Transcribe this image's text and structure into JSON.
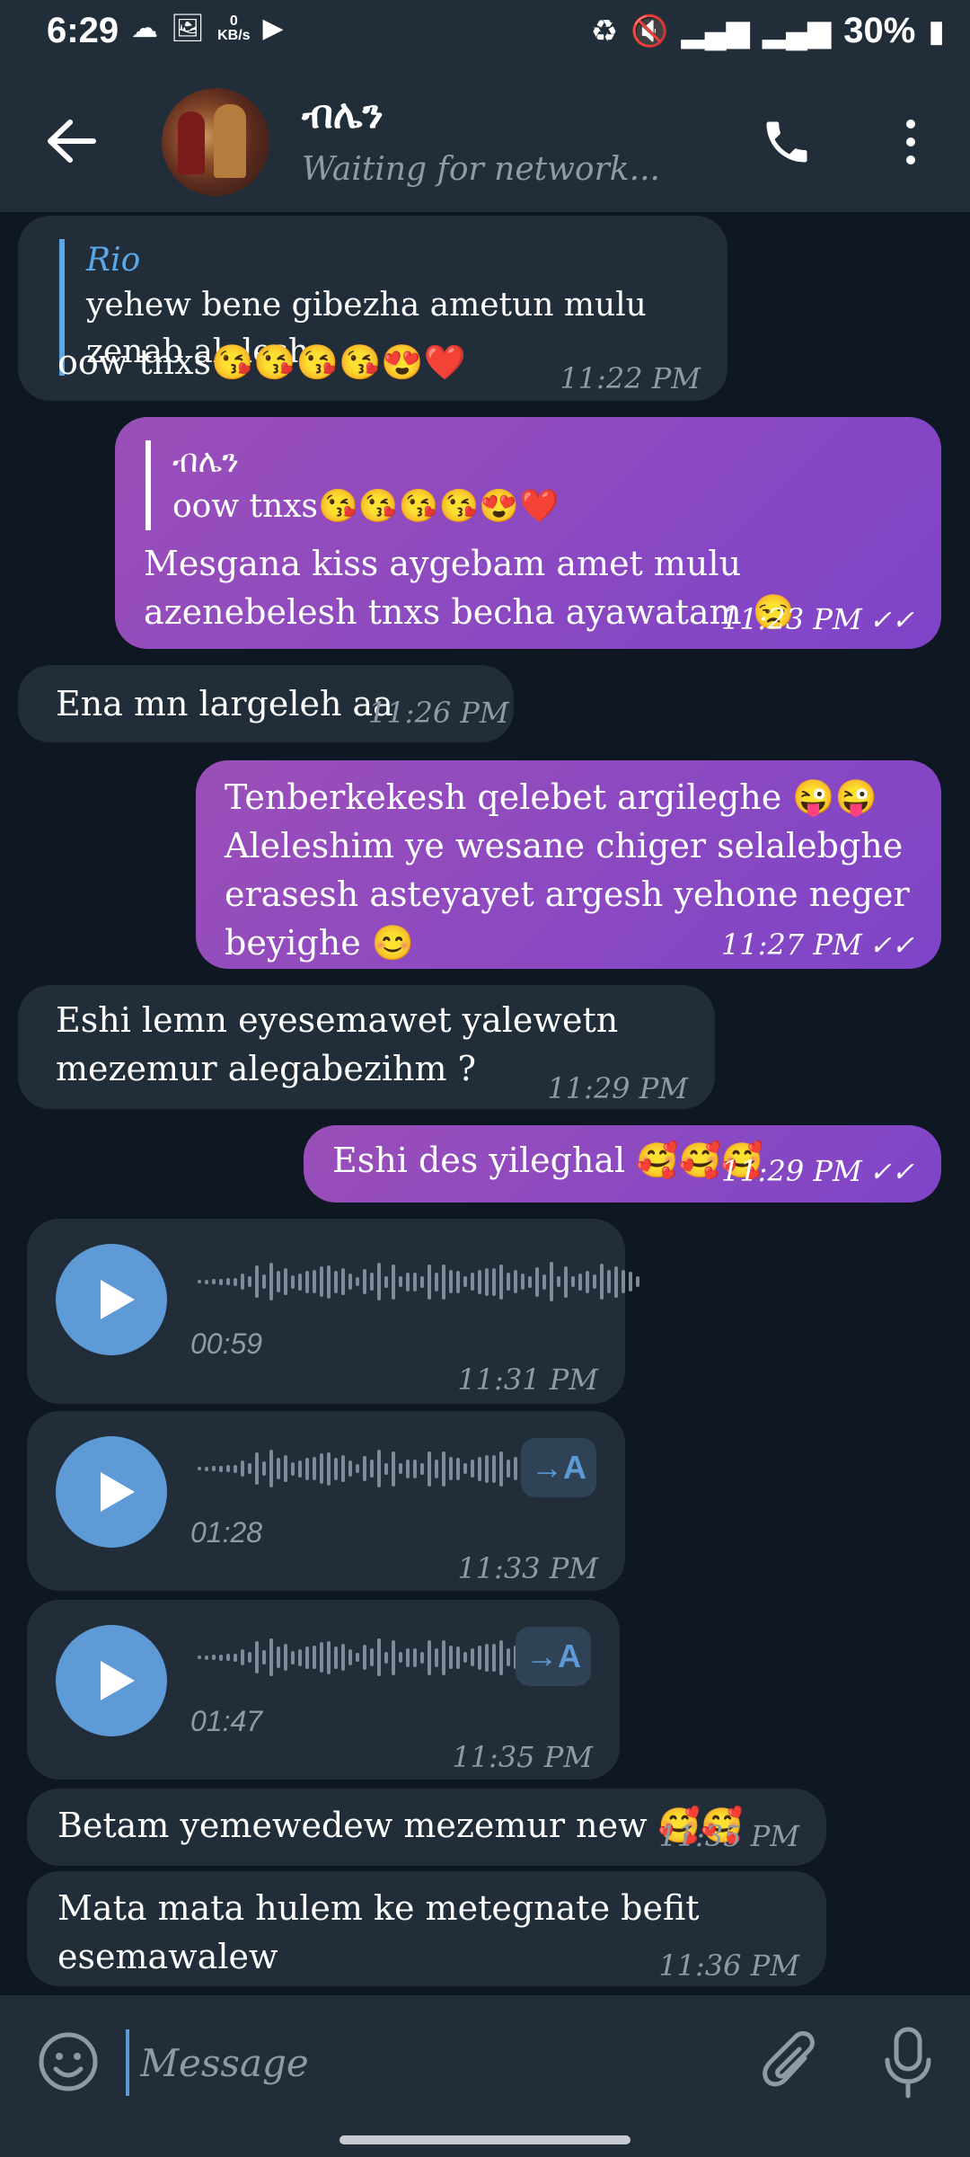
{
  "status_bar": {
    "time": "6:29",
    "kbs_value": "0",
    "kbs_unit": "KB/s",
    "battery": "30%"
  },
  "header": {
    "contact_name": "ብሌን",
    "status": "Waiting for network..."
  },
  "messages": [
    {
      "type": "text",
      "direction": "in",
      "reply_to_name": "Rio",
      "reply_to_text": "yehew bene gibezha ametun mulu zenab alelesh",
      "text": "oow tnxs😘😘😘😘😍❤️",
      "time": "11:22 PM"
    },
    {
      "type": "text",
      "direction": "out",
      "reply_to_name": "ብሌን",
      "reply_to_text": "oow tnxs😘😘😘😘😍❤️",
      "text": "Mesgana kiss aygebam amet mulu azenebelesh tnxs becha ayawatam 😒",
      "time": "11:23 PM",
      "read": true
    },
    {
      "type": "text",
      "direction": "in",
      "text": "Ena mn largeleh aa",
      "time": "11:26 PM"
    },
    {
      "type": "text",
      "direction": "out",
      "text": "Tenberkekesh qelebet argileghe 😜😜 Aleleshim ye wesane chiger selalebghe erasesh asteyayet argesh yehone neger beyighe 😊",
      "time": "11:27 PM",
      "read": true
    },
    {
      "type": "text",
      "direction": "in",
      "text": "Eshi lemn eyesemawet yalewetn mezemur alegabezihm ?",
      "time": "11:29 PM"
    },
    {
      "type": "text",
      "direction": "out",
      "text": "Eshi des yileghal 🥰🥰🥰",
      "time": "11:29 PM",
      "read": true
    },
    {
      "type": "voice",
      "direction": "in",
      "duration": "00:59",
      "time": "11:31 PM"
    },
    {
      "type": "voice",
      "direction": "in",
      "duration": "01:28",
      "time": "11:33 PM",
      "transcribe_label": "→A"
    },
    {
      "type": "voice",
      "direction": "in",
      "duration": "01:47",
      "time": "11:35 PM",
      "transcribe_label": "→A"
    },
    {
      "type": "text",
      "direction": "in",
      "text": "Betam yemewedew mezemur new 🥰🥰",
      "time": "11:35 PM"
    },
    {
      "type": "text",
      "direction": "in",
      "text": "Mata mata hulem ke metegnate befit esemawalew",
      "time": "11:36 PM"
    }
  ],
  "composer": {
    "placeholder": "Message"
  },
  "icons": [
    "cloud-icon",
    "image-icon",
    "play-circle-icon",
    "recycle-icon",
    "mute-icon",
    "signal-icon",
    "battery-icon",
    "back-arrow-icon",
    "phone-icon",
    "more-vertical-icon",
    "play-icon",
    "read-ticks-icon",
    "emoji-icon",
    "attach-icon",
    "mic-icon"
  ],
  "colors": {
    "background": "#0f1822",
    "bar": "#222d3a",
    "incoming_bubble": "#222d3a",
    "outgoing_bubble_start": "#9b4fb8",
    "outgoing_bubble_end": "#7e44c8",
    "accent": "#5d9ad6",
    "muted_text": "#8f9aa7"
  }
}
